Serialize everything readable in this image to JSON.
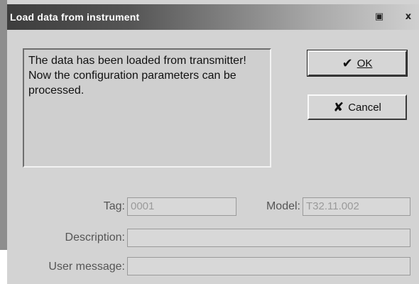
{
  "window": {
    "title": "Load data from instrument",
    "help_glyph": "▣",
    "close_glyph": "x"
  },
  "message": "The data has been loaded from transmitter!\nNow the configuration parameters  can be\nprocessed.",
  "buttons": {
    "ok_label": "OK",
    "ok_icon": "✔",
    "cancel_label": "Cancel",
    "cancel_icon": "✘"
  },
  "fields": {
    "tag_label": "Tag:",
    "tag_value": "0001",
    "model_label": "Model:",
    "model_value": "T32.11.002",
    "description_label": "Description:",
    "description_value": "",
    "user_message_label": "User message:",
    "user_message_value": ""
  }
}
